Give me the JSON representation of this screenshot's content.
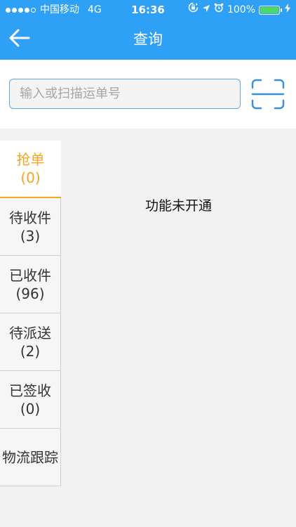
{
  "status_bar": {
    "carrier": "中国移动",
    "network": "4G",
    "time": "16:36",
    "battery": "100%",
    "signal_strength": "4 of 5",
    "battery_level": 1.0,
    "icons": [
      "signal-dots-icon",
      "orientation-lock-icon",
      "location-arrow-icon",
      "alarm-icon",
      "battery-icon",
      "charging-bolt-icon"
    ]
  },
  "header": {
    "title": "查询",
    "back_icon": "arrow-left-icon"
  },
  "search": {
    "placeholder": "输入或扫描运单号",
    "value": "",
    "scan_icon": "scan-frame-icon"
  },
  "sidebar": {
    "items": [
      {
        "label": "抢单",
        "count": "(0)",
        "active": true
      },
      {
        "label": "待收件",
        "count": "(3)",
        "active": false
      },
      {
        "label": "已收件",
        "count": "(96)",
        "active": false
      },
      {
        "label": "待派送",
        "count": "(2)",
        "active": false
      },
      {
        "label": "已签收",
        "count": "(0)",
        "active": false
      },
      {
        "label": "物流跟踪",
        "count": "",
        "active": false
      }
    ]
  },
  "content": {
    "message": "功能未开通"
  },
  "colors": {
    "primary": "#2ea0f5",
    "active_tab": "#f5a623",
    "battery_fill": "#4cd964",
    "input_border": "#5fa8e0",
    "scan_icon": "#3a8fd9"
  }
}
